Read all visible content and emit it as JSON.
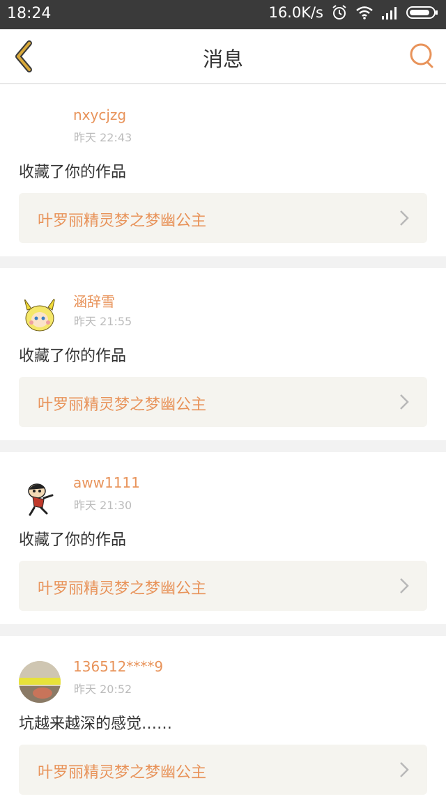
{
  "status": {
    "time": "18:24",
    "speed": "16.0K/s"
  },
  "nav": {
    "title": "消息"
  },
  "messages": [
    {
      "user": "nxycjzg",
      "time": "昨天 22:43",
      "text": "收藏了你的作品",
      "work": "叶罗丽精灵梦之梦幽公主"
    },
    {
      "user": "涵辞雪",
      "time": "昨天 21:55",
      "text": "收藏了你的作品",
      "work": "叶罗丽精灵梦之梦幽公主"
    },
    {
      "user": "aww1111",
      "time": "昨天 21:30",
      "text": "收藏了你的作品",
      "work": "叶罗丽精灵梦之梦幽公主"
    },
    {
      "user": "136512****9",
      "time": "昨天 20:52",
      "text": "坑越来越深的感觉……",
      "work": "叶罗丽精灵梦之梦幽公主"
    }
  ],
  "colors": {
    "accent": "#e8935a",
    "back_icon": "#d9a93a",
    "link_bg": "#f5f4ef",
    "status_bg": "#3a3a3a"
  },
  "icons": [
    "alarm-icon",
    "wifi-icon",
    "signal-icon",
    "battery-icon",
    "back-arrow-icon",
    "search-icon",
    "chevron-right-icon"
  ]
}
